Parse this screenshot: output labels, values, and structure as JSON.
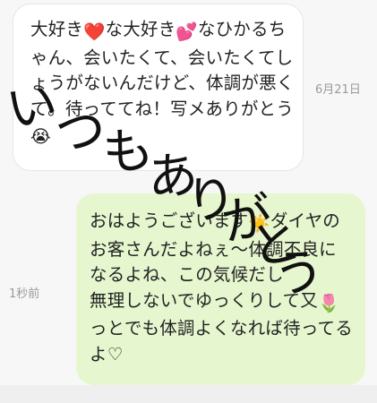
{
  "messages": {
    "received": {
      "lines": [
        {
          "pre": "大好き",
          "emoji": "❤️",
          "post": "な大好き"
        },
        {
          "pre": "",
          "emoji": "💕",
          "post": "なひかるち"
        },
        {
          "pre": "ゃん、会いたくて、会いたくてし",
          "emoji": "",
          "post": ""
        },
        {
          "pre": "ょうがないんだけど、体調が悪く",
          "emoji": "",
          "post": ""
        },
        {
          "pre": "て。待っててね！写メありがとう",
          "emoji": "",
          "post": ""
        },
        {
          "pre": "",
          "emoji": "😭",
          "post": ""
        }
      ],
      "timestamp": "6月21日"
    },
    "sent": {
      "lines": [
        {
          "pre": "おはようございます",
          "emoji": "☀️",
          "post": "ダイヤの"
        },
        {
          "pre": "お客さんだよねぇ〜",
          "emoji": "",
          "post": "体調不良に"
        },
        {
          "pre": "なるよね、この気候だし",
          "emoji": "",
          "post": ""
        },
        {
          "pre": "無理しないでゆっくりして又",
          "emoji": "🌷",
          "post": ""
        },
        {
          "pre": "っとでも体調よくなれば待ってる",
          "emoji": "",
          "post": ""
        },
        {
          "pre": "よ♡",
          "emoji": "",
          "post": ""
        }
      ],
      "timestamp": "1秒前"
    }
  },
  "overlay": {
    "handwritten_chars": [
      "い",
      "つ",
      "も",
      "あ",
      "り",
      "が",
      "と",
      "う"
    ]
  }
}
